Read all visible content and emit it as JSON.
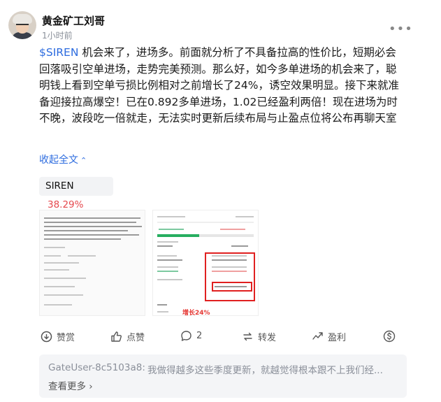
{
  "post": {
    "author": "黄金矿工刘哥",
    "time": "1小时前",
    "more_label": "•••",
    "ticker": "$SIREN",
    "body_after_ticker": " 机会来了，进场多。前面就分析了不具备拉高的性价比，短期必会回落吸引空单进场，走势完美预测。那么好，如今多单进场的机会来了，聪明钱上看到空单亏损比例相对之前增长了24%，诱空效果明显。接下来就准备迎接拉高爆空！已在0.892多单进场，1.02已经盈利两倍！现在进场为时不晚，波段吃一倍就走，无法实时更新后续布局与止盈点位将公布再聊天室",
    "collapse_label": "收起全文",
    "tag": {
      "symbol": "SIREN",
      "change": "38.29%"
    },
    "image2_annotation": "增长24%",
    "actions": {
      "tip": "赞赏",
      "like": "点赞",
      "comment_count": "2",
      "repost": "转发",
      "earn": "盈利"
    },
    "comment": {
      "user": "GateUser-8c5103a8:",
      "text": "我做得越多这些季度更新，就越觉得根本跟不上我们经...",
      "view_more": "查看更多"
    }
  },
  "icons": [
    "tip-icon",
    "like-icon",
    "comment-icon",
    "repost-icon",
    "earn-icon",
    "dollar-icon",
    "chevron-up-icon",
    "chevron-right-icon"
  ],
  "colors": {
    "accent": "#2d6cdf",
    "up": "#e5484d",
    "annotation": "#e02020"
  }
}
